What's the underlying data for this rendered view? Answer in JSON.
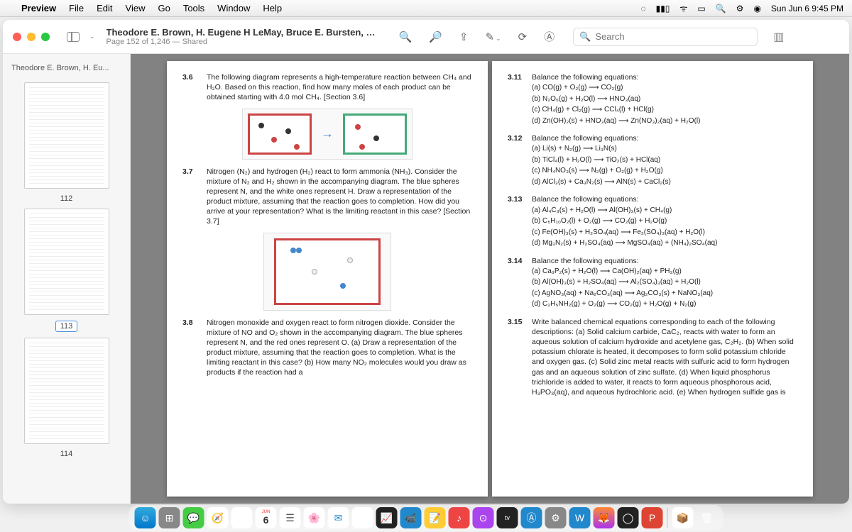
{
  "menubar": {
    "app": "Preview",
    "items": [
      "File",
      "Edit",
      "View",
      "Go",
      "Tools",
      "Window",
      "Help"
    ],
    "clock": "Sun Jun 6  9:45 PM"
  },
  "titlebar": {
    "doc_title": "Theodore E. Brown, H. Eugene H LeMay, Bruce E. Bursten, Cather...",
    "doc_sub": "Page 152 of 1,246 — Shared",
    "search_placeholder": "Search"
  },
  "sidebar": {
    "label": "Theodore E. Brown, H. Eu...",
    "pages": [
      "112",
      "113",
      "114"
    ]
  },
  "left_page": {
    "p36": {
      "num": "3.6",
      "text": "The following diagram represents a high-temperature reaction between CH₄ and H₂O. Based on this reaction, find how many moles of each product can be obtained starting with 4.0 mol CH₄. [Section 3.6]"
    },
    "p37": {
      "num": "3.7",
      "text": "Nitrogen (N₂) and hydrogen (H₂) react to form ammonia (NH₃). Consider the mixture of N₂ and H₂ shown in the accompanying diagram. The blue spheres represent N, and the white ones represent H. Draw a representation of the product mixture, assuming that the reaction goes to completion. How did you arrive at your representation? What is the limiting reactant in this case? [Section 3.7]"
    },
    "p38": {
      "num": "3.8",
      "text": "Nitrogen monoxide and oxygen react to form nitrogen dioxide. Consider the mixture of NO and O₂ shown in the accompanying diagram. The blue spheres represent N, and the red ones represent O. (a) Draw a representation of the product mixture, assuming that the reaction goes to completion. What is the limiting reactant in this case? (b) How many NO₂ molecules would you draw as products if the reaction had a"
    }
  },
  "right_page": {
    "p311": {
      "num": "3.11",
      "text": "Balance the following equations:",
      "items": [
        "(a)  CO(g) + O₂(g)  ⟶  CO₂(g)",
        "(b)  N₂O₅(g) + H₂O(l)  ⟶  HNO₃(aq)",
        "(c)  CH₄(g) + Cl₂(g)  ⟶  CCl₄(l) + HCl(g)",
        "(d)  Zn(OH)₂(s) + HNO₃(aq)  ⟶  Zn(NO₃)₂(aq) + H₂O(l)"
      ]
    },
    "p312": {
      "num": "3.12",
      "text": "Balance the following equations:",
      "items": [
        "(a)  Li(s) + N₂(g)  ⟶  Li₃N(s)",
        "(b)  TiCl₄(l) + H₂O(l)  ⟶  TiO₂(s) + HCl(aq)",
        "(c)  NH₄NO₃(s)  ⟶  N₂(g) + O₂(g) + H₂O(g)",
        "(d)  AlCl₃(s) + Ca₃N₂(s)  ⟶  AlN(s) + CaCl₂(s)"
      ]
    },
    "p313": {
      "num": "3.13",
      "text": "Balance the following equations:",
      "items": [
        "(a)  Al₄C₃(s) + H₂O(l)  ⟶  Al(OH)₃(s) + CH₄(g)",
        "(b)  C₅H₁₀O₂(l) + O₂(g)  ⟶  CO₂(g) + H₂O(g)",
        "(c)  Fe(OH)₃(s) + H₂SO₄(aq)  ⟶  Fe₂(SO₄)₃(aq) + H₂O(l)",
        "(d)  Mg₃N₂(s) + H₂SO₄(aq)  ⟶  MgSO₄(aq) + (NH₄)₂SO₄(aq)"
      ]
    },
    "p314": {
      "num": "3.14",
      "text": "Balance the following equations:",
      "items": [
        "(a)  Ca₃P₂(s) + H₂O(l)  ⟶  Ca(OH)₂(aq) + PH₃(g)",
        "(b)  Al(OH)₃(s) + H₂SO₄(aq)  ⟶  Al₂(SO₄)₃(aq) + H₂O(l)",
        "(c)  AgNO₃(aq) + Na₂CO₃(aq)  ⟶  Ag₂CO₃(s) + NaNO₃(aq)",
        "(d)  C₂H₅NH₂(g) + O₂(g)  ⟶  CO₂(g) + H₂O(g) + N₂(g)"
      ]
    },
    "p315": {
      "num": "3.15",
      "text": "Write balanced chemical equations corresponding to each of the following descriptions: (a) Solid calcium carbide, CaC₂, reacts with water to form an aqueous solution of calcium hydroxide and acetylene gas, C₂H₂. (b) When solid potassium chlorate is heated, it decomposes to form solid potassium chloride and oxygen gas. (c) Solid zinc metal reacts with sulfuric acid to form hydrogen gas and an aqueous solution of zinc sulfate. (d) When liquid phosphorus trichloride is added to water, it reacts to form aqueous phosphorous acid, H₃PO₃(aq), and aqueous hydrochloric acid. (e) When hydrogen sulfide gas is"
    }
  },
  "dock": {
    "cal_month": "JUN",
    "cal_day": "6",
    "tv_label": "tv"
  }
}
